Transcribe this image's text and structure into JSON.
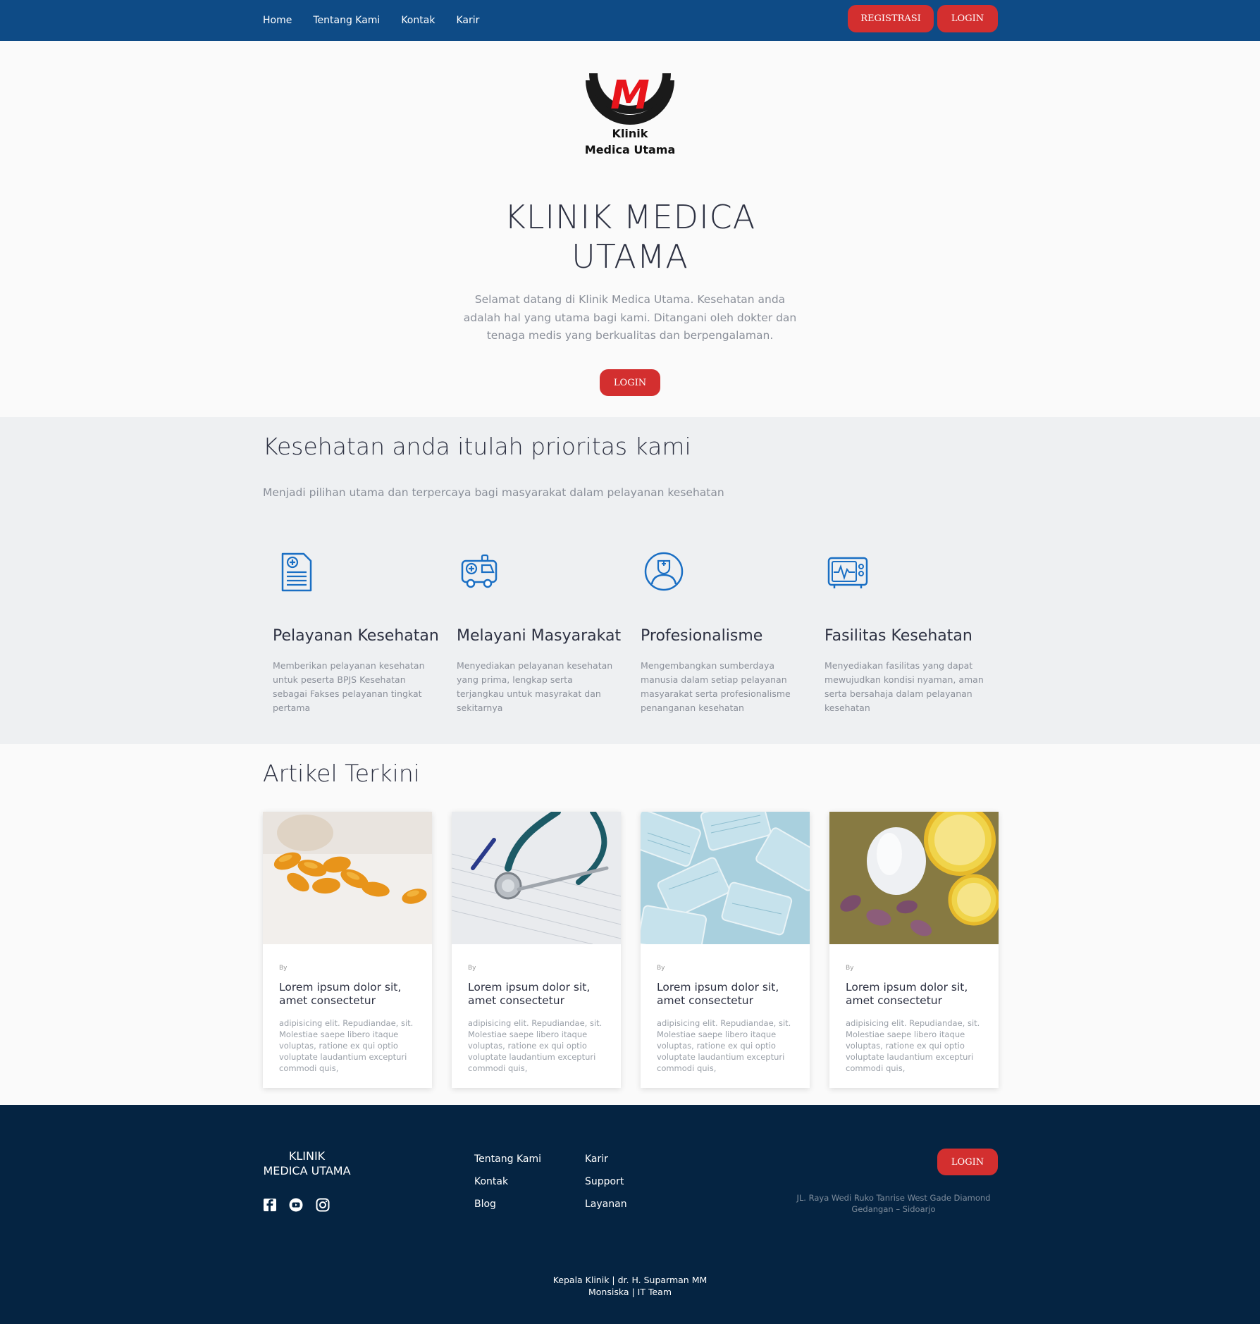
{
  "nav": {
    "links": [
      "Home",
      "Tentang Kami",
      "Kontak",
      "Karir"
    ],
    "register_label": "REGISTRASI",
    "login_label": "LOGIN"
  },
  "logo": {
    "letter": "M",
    "line1": "Klinik",
    "line2": "Medica Utama"
  },
  "hero": {
    "title_line1": "KLINIK MEDICA",
    "title_line2": "UTAMA",
    "text": "Selamat datang di Klinik Medica Utama. Kesehatan anda adalah hal yang utama bagi kami. Ditangani oleh dokter dan tenaga medis yang berkualitas dan berpengalaman.",
    "login_label": "LOGIN"
  },
  "priority": {
    "title": "Kesehatan anda itulah prioritas kami",
    "subtitle": "Menjadi pilihan utama dan terpercaya bagi masyarakat dalam pelayanan kesehatan",
    "features": [
      {
        "icon": "document-medical-icon",
        "title": "Pelayanan Kesehatan",
        "text": "Memberikan pelayanan kesehatan untuk peserta BPJS Kesehatan sebagai Fakses pelayanan tingkat pertama"
      },
      {
        "icon": "ambulance-icon",
        "title": "Melayani Masyarakat",
        "text": "Menyediakan pelayanan kesehatan yang prima, lengkap serta terjangkau untuk masyrakat dan sekitarnya"
      },
      {
        "icon": "doctor-icon",
        "title": "Profesionalisme",
        "text": "Mengembangkan sumberdaya manusia dalam setiap pelayanan masyarakat serta profesionalisme penanganan kesehatan"
      },
      {
        "icon": "monitor-heart-icon",
        "title": "Fasilitas Kesehatan",
        "text": "Menyediakan fasilitas yang dapat mewujudkan kondisi nyaman, aman serta bersahaja dalam pelayanan kesehatan"
      }
    ]
  },
  "articles": {
    "title": "Artikel Terkini",
    "items": [
      {
        "image": "capsules-image",
        "by": "By",
        "title": "Lorem ipsum dolor sit, amet consectetur",
        "text": "adipisicing elit. Repudiandae, sit. Molestiae saepe libero itaque voluptas, ratione ex qui optio voluptate laudantium excepturi commodi quis,"
      },
      {
        "image": "stethoscope-image",
        "by": "By",
        "title": "Lorem ipsum dolor sit, amet consectetur",
        "text": "adipisicing elit. Repudiandae, sit. Molestiae saepe libero itaque voluptas, ratione ex qui optio voluptate laudantium excepturi commodi quis,"
      },
      {
        "image": "masks-image",
        "by": "By",
        "title": "Lorem ipsum dolor sit, amet consectetur",
        "text": "adipisicing elit. Repudiandae, sit. Molestiae saepe libero itaque voluptas, ratione ex qui optio voluptate laudantium excepturi commodi quis,"
      },
      {
        "image": "garlic-lemon-image",
        "by": "By",
        "title": "Lorem ipsum dolor sit, amet consectetur",
        "text": "adipisicing elit. Repudiandae, sit. Molestiae saepe libero itaque voluptas, ratione ex qui optio voluptate laudantium excepturi commodi quis,"
      }
    ]
  },
  "footer": {
    "brand_line1": "KLINIK",
    "brand_line2": "MEDICA UTAMA",
    "social": [
      "facebook-icon",
      "youtube-icon",
      "instagram-icon"
    ],
    "col1": [
      "Tentang Kami",
      "Kontak",
      "Blog"
    ],
    "col2": [
      "Karir",
      "Support",
      "Layanan"
    ],
    "login_label": "LOGIN",
    "address": "JL. Raya Wedi Ruko Tanrise West Gade Diamond Gedangan – Sidoarjo",
    "credit_line1": "Kepala Klinik | dr. H. Suparman MM",
    "credit_line2": "Monsiska | IT Team"
  },
  "colors": {
    "nav": "#0e4b86",
    "accent": "#d32f2f",
    "footer": "#052442",
    "icon": "#1a6fc4"
  }
}
